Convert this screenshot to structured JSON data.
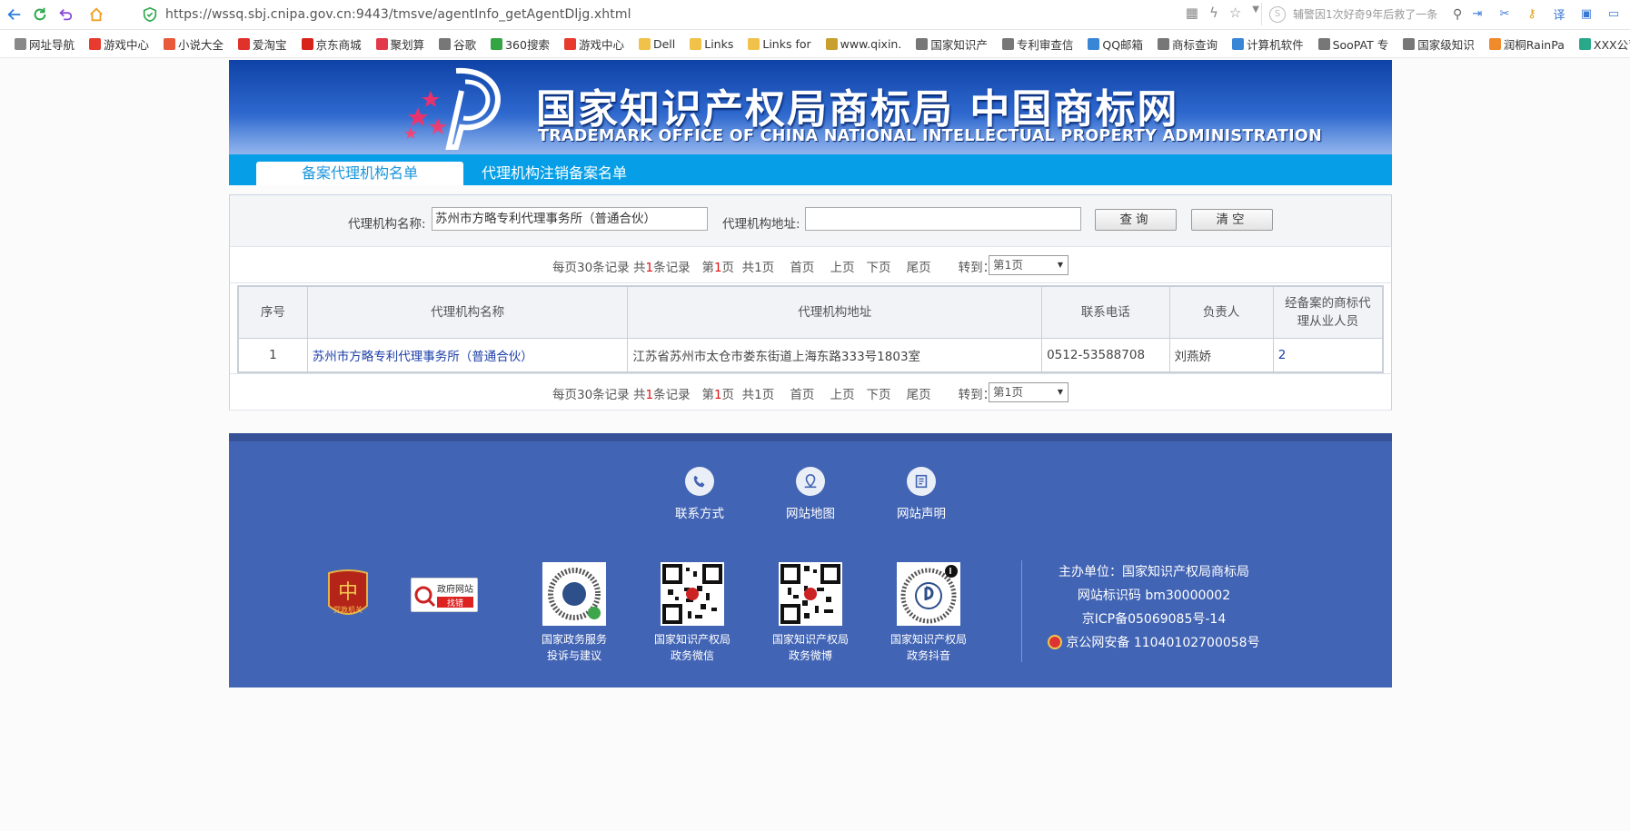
{
  "browser": {
    "url": "https://wssq.sbj.cnipa.gov.cn:9443/tmsve/agentInfo_getAgentDljg.xhtml",
    "search_hint": "辅警因1次好奇9年后救了一条",
    "bookmarks": [
      {
        "label": "网址导航",
        "color": "#888888"
      },
      {
        "label": "游戏中心",
        "color": "#e63b2e"
      },
      {
        "label": "小说大全",
        "color": "#e85a3a"
      },
      {
        "label": "爱淘宝",
        "color": "#e0322b"
      },
      {
        "label": "京东商城",
        "color": "#d8231a"
      },
      {
        "label": "聚划算",
        "color": "#e23a4a"
      },
      {
        "label": "谷歌",
        "color": "#777777"
      },
      {
        "label": "360搜索",
        "color": "#35a543"
      },
      {
        "label": "游戏中心",
        "color": "#e63b2e"
      },
      {
        "label": "Dell",
        "color": "#f0c24a"
      },
      {
        "label": "Links",
        "color": "#f0c24a"
      },
      {
        "label": "Links for",
        "color": "#f0c24a"
      },
      {
        "label": "www.qixin.",
        "color": "#c8a030"
      },
      {
        "label": "国家知识产",
        "color": "#777777"
      },
      {
        "label": "专利审查信",
        "color": "#777777"
      },
      {
        "label": "QQ邮箱",
        "color": "#3a86d6"
      },
      {
        "label": "商标查询",
        "color": "#777777"
      },
      {
        "label": "计算机软件",
        "color": "#3a86d6"
      },
      {
        "label": "SooPAT 专",
        "color": "#777777"
      },
      {
        "label": "国家级知识",
        "color": "#777777"
      },
      {
        "label": "润桐RainPa",
        "color": "#f08a2a"
      },
      {
        "label": "XXX公司",
        "color": "#2aa88a"
      }
    ]
  },
  "banner": {
    "title_cn": "国家知识产权局商标局 中国商标网",
    "title_en": "TRADEMARK OFFICE OF CHINA NATIONAL INTELLECTUAL PROPERTY ADMINISTRATION"
  },
  "tabs": {
    "active": "备案代理机构名单",
    "inactive": "代理机构注销备案名单"
  },
  "search": {
    "name_label": "代理机构名称:",
    "name_value": "苏州市方略专利代理事务所（普通合伙）",
    "address_label": "代理机构地址:",
    "address_value": "",
    "query_button": "查询",
    "clear_button": "清空"
  },
  "pager": {
    "per_page": "每页30条记录",
    "total_prefix": "共",
    "total_count": "1",
    "total_suffix": "条记录",
    "page_prefix": "第",
    "current_page": "1",
    "page_suffix": "页",
    "page_total": "共1页",
    "first": "首页",
    "prev": "上页",
    "next": "下页",
    "last": "尾页",
    "goto_label": "转到：",
    "goto_value": "第1页"
  },
  "table": {
    "headers": [
      "序号",
      "代理机构名称",
      "代理机构地址",
      "联系电话",
      "负责人",
      "经备案的商标代理从业人员"
    ],
    "rows": [
      {
        "index": "1",
        "name": "苏州市方略专利代理事务所（普通合伙）",
        "address": "江苏省苏州市太仓市娄东街道上海东路333号1803室",
        "phone": "0512-53588708",
        "leader": "刘燕娇",
        "staff": "2"
      }
    ]
  },
  "footer": {
    "nav": [
      {
        "label": "联系方式",
        "icon": "phone-icon"
      },
      {
        "label": "网站地图",
        "icon": "map-pin-icon"
      },
      {
        "label": "网站声明",
        "icon": "document-icon"
      }
    ],
    "badge_gov_text": "政府网站",
    "badge_gov_sub": "找错",
    "badge_dang_text": "党政机关",
    "qrcodes": [
      {
        "caption1": "国家政务服务",
        "caption2": "投诉与建议"
      },
      {
        "caption1": "国家知识产权局",
        "caption2": "政务微信"
      },
      {
        "caption1": "国家知识产权局",
        "caption2": "政务微博"
      },
      {
        "caption1": "国家知识产权局",
        "caption2": "政务抖音"
      }
    ],
    "info": {
      "host": "主办单位：国家知识产权局商标局",
      "site_id": "网站标识码 bm30000002",
      "icp": "京ICP备05069085号-14",
      "police": "京公网安备 11040102700058号"
    }
  },
  "colors": {
    "banner": "#1d55bf",
    "tabbar": "#069fe7",
    "footer": "#4264b4",
    "link": "#1b3ea8",
    "highlight": "#e01010"
  }
}
